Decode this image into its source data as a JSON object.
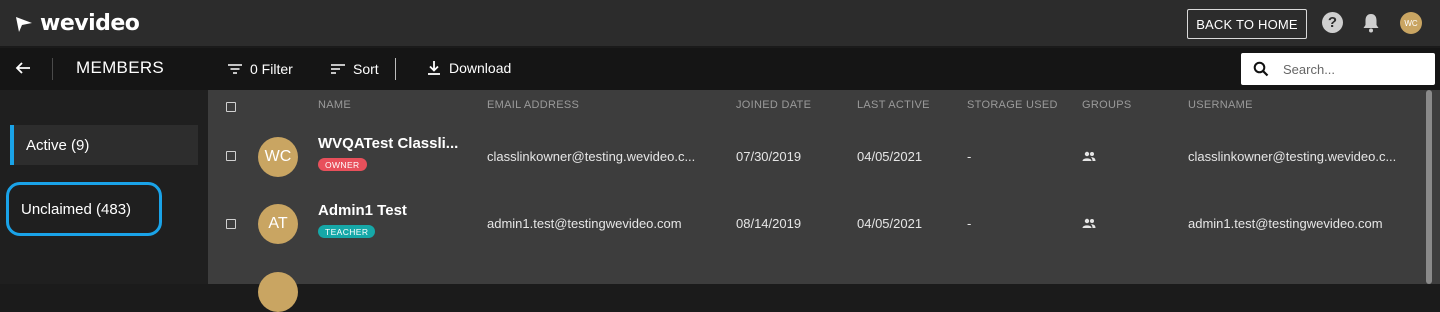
{
  "header": {
    "logo_text": "wevideo",
    "back_home_label": "BACK TO HOME",
    "help_symbol": "?",
    "user_initials": "WC",
    "icons": {
      "help": "help-circle-icon",
      "notifications": "bell-icon",
      "logo": "wevideo-logo-icon"
    }
  },
  "toolbar": {
    "title": "MEMBERS",
    "filter_label": "0 Filter",
    "sort_label": "Sort",
    "download_label": "Download",
    "search_placeholder": "Search...",
    "icons": {
      "back": "arrow-left-icon",
      "filter": "filter-icon",
      "sort": "sort-icon",
      "download": "download-icon",
      "search": "search-icon"
    }
  },
  "sidebar": {
    "items": [
      {
        "label": "Active (9)",
        "selected": true
      },
      {
        "label": "Unclaimed (483)",
        "selected": false,
        "highlighted": true
      }
    ]
  },
  "table": {
    "columns": [
      "NAME",
      "EMAIL ADDRESS",
      "JOINED DATE",
      "LAST ACTIVE",
      "STORAGE USED",
      "GROUPS",
      "USERNAME"
    ],
    "rows": [
      {
        "initials": "WC",
        "name": "WVQATest Classli...",
        "role": "OWNER",
        "email": "classlinkowner@testing.wevideo.c...",
        "joined": "07/30/2019",
        "last_active": "04/05/2021",
        "storage": "-",
        "groups_icon": "groups-icon",
        "username": "classlinkowner@testing.wevideo.c..."
      },
      {
        "initials": "AT",
        "name": "Admin1 Test",
        "role": "TEACHER",
        "email": "admin1.test@testingwevideo.com",
        "joined": "08/14/2019",
        "last_active": "04/05/2021",
        "storage": "-",
        "groups_icon": "groups-icon",
        "username": "admin1.test@testingwevideo.com"
      }
    ]
  },
  "colors": {
    "accent_blue": "#1aa3e8",
    "avatar_gold": "#c9a562",
    "owner_badge": "#e8505b",
    "teacher_badge": "#16a8a8"
  }
}
